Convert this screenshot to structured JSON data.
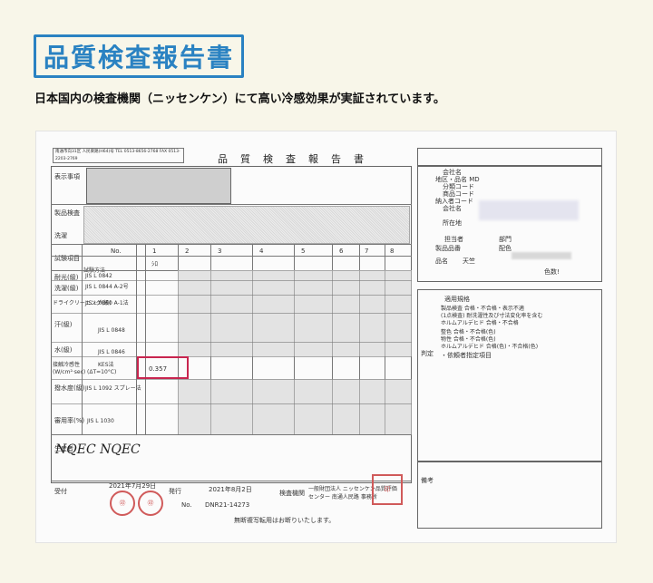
{
  "title": "品質検査報告書",
  "subtitle": "日本国内の検査機関（ニッセンケン）にて高い冷感効果が実証されています。",
  "document": {
    "header": "品質検査報告書",
    "address": "南通市向31区 人民東路(H64)号 TEL 0513-8656-2768 FAX 0513-2203-2769",
    "labels": {
      "client": "表示事項",
      "material": "製品検査",
      "wash": "洗濯",
      "item": "試験項目",
      "method": "試験方法",
      "lightfastness": "耐光(級)",
      "washfast": "洗濯(級)",
      "drycleaning": "ドライクリーニング(級)",
      "sweat": "汗(級)",
      "water": "水(級)",
      "cool": "接触冷感性",
      "water_repel": "撥水度(級)",
      "use": "審用率(%)",
      "processing": "生産者",
      "judgement": "判定",
      "remarks": "備考",
      "standard_lines": [
        "JIS L 0842",
        "JIS L 0844 A-2号",
        "JIS L 0860 A-1法",
        "JIS L 0848",
        "JIS L 0846",
        "KES法",
        "JIS L 1092 スプレー法",
        "JIS L 1030"
      ],
      "cool_unit": "(W/cm²·sec)",
      "cool_cond": "(ΔT=10°C)",
      "cool_value": "0.357",
      "sample_no": "No.",
      "sample_1": "1",
      "sample_2": "2",
      "sample_3": "3",
      "sample_4": "4",
      "sample_5": "5",
      "sample_6": "6",
      "sample_7": "7",
      "sample_8": "8",
      "sample_val": "ｼﾛ"
    },
    "right_panel": {
      "company": "会社名",
      "area": "地区・品名 MD",
      "category": "分類コード",
      "product_code": "商品コード",
      "buyer_code": "納入者コード",
      "buyer_company": "会社名",
      "address": "所在地",
      "manager": "担当者",
      "dept": "部門",
      "product_name": "品名",
      "product_value": "天竺",
      "colors": "色数!",
      "product_no": "製品品番",
      "match_color": "配色",
      "judgement_std": "適用規格",
      "judgement_lines": [
        "製品検査 合格・不合格・表示不適",
        "(1点検査) 耐洗濯性及び寸法変化率を含む",
        "ホルムアルデヒド 合格・不合格",
        "整色 合格・不合格(色)",
        "物性 合格・不合格(色)",
        "ホルムアルデヒド 合格(色)・不合格(色)"
      ],
      "notes_1": "・依頼者指定項目",
      "biko": "備考"
    },
    "footer": {
      "receive_date_label": "受付",
      "receive_date": "2021年7月29日",
      "issue_label": "発行",
      "issue_date": "2021年8月2日",
      "no_label": "No.",
      "number": "DNR21-14273",
      "org_label": "検査機関",
      "org": "一般財団法人 ニッセンケン品質評価センター 南通人民路 事務所",
      "disclaimer": "無断複写転用はお断りいたします。",
      "nqec": "NQEC  NQEC"
    }
  },
  "colors": {
    "accent": "#2a82c2",
    "highlight": "#c8254f",
    "background": "#f8f6e9",
    "seal": "#d05a5a"
  }
}
